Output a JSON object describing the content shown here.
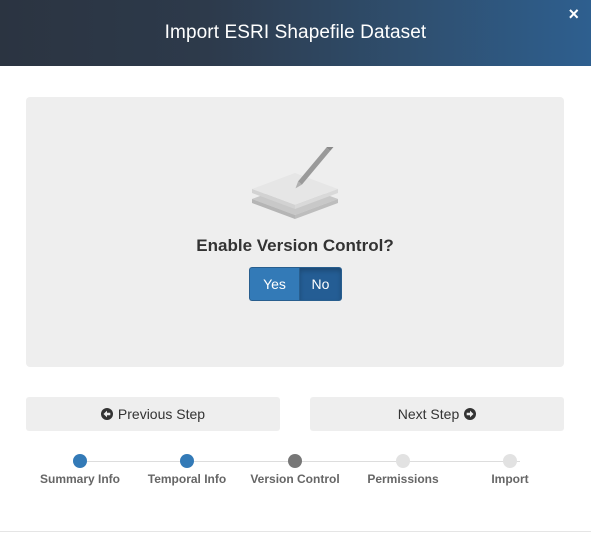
{
  "dialog": {
    "title": "Import ESRI Shapefile Dataset",
    "close_glyph": "×"
  },
  "panel": {
    "icon": "layers-edit-icon",
    "question": "Enable Version Control?",
    "options": [
      {
        "label": "Yes",
        "selected": false
      },
      {
        "label": "No",
        "selected": true
      }
    ]
  },
  "navigation": {
    "previous": {
      "label": "Previous Step",
      "icon": "arrow-circle-left-icon"
    },
    "next": {
      "label": "Next Step",
      "icon": "arrow-circle-right-icon"
    }
  },
  "steps": [
    {
      "label": "Summary Info",
      "status": "done"
    },
    {
      "label": "Temporal Info",
      "status": "done"
    },
    {
      "label": "Version Control",
      "status": "current"
    },
    {
      "label": "Permissions",
      "status": "todo"
    },
    {
      "label": "Import",
      "status": "todo"
    }
  ],
  "colors": {
    "accent": "#337ab7",
    "accent_active": "#245d94",
    "current_step": "#777777",
    "pending_step": "#e2e2e2"
  }
}
